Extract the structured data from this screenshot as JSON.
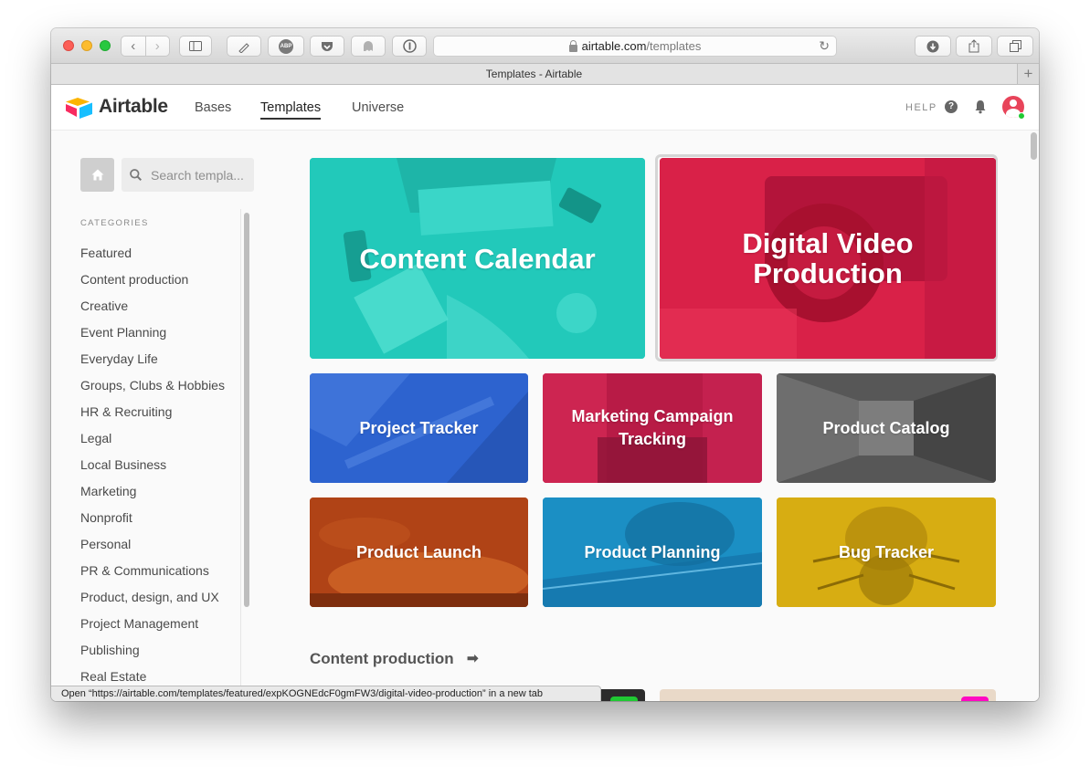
{
  "browser": {
    "url_domain": "airtable.com",
    "url_path": "/templates",
    "tab_title": "Templates - Airtable",
    "status_text": "Open “https://airtable.com/templates/featured/expKOGNEdcF0gmFW3/digital-video-production” in a new tab",
    "toolbar_icons": [
      "back-icon",
      "forward-icon",
      "sidebar-icon",
      "css-extension-icon",
      "adblock-plus-icon",
      "pocket-icon",
      "ghostery-icon",
      "onepassword-icon",
      "download-icon",
      "share-icon",
      "tabs-icon"
    ],
    "abp_label": "ABP",
    "css_label": "CSS"
  },
  "header": {
    "logo_text": "Airtable",
    "nav": [
      {
        "label": "Bases",
        "active": false
      },
      {
        "label": "Templates",
        "active": true
      },
      {
        "label": "Universe",
        "active": false
      }
    ],
    "help_label": "HELP"
  },
  "sidebar": {
    "search_placeholder": "Search templa...",
    "categories_label": "CATEGORIES",
    "categories": [
      "Featured",
      "Content production",
      "Creative",
      "Event Planning",
      "Everyday Life",
      "Groups, Clubs & Hobbies",
      "HR & Recruiting",
      "Legal",
      "Local Business",
      "Marketing",
      "Nonprofit",
      "Personal",
      "PR & Communications",
      "Product, design, and UX",
      "Project Management",
      "Publishing",
      "Real Estate"
    ]
  },
  "featured": {
    "big": [
      {
        "title": "Content Calendar",
        "color": "#22c9ba"
      },
      {
        "title_line1": "Digital Video",
        "title_line2": "Production",
        "color": "#d92148"
      }
    ],
    "small": [
      {
        "title": "Project Tracker",
        "color": "#2d63cf"
      },
      {
        "title_line1": "Marketing Campaign",
        "title_line2": "Tracking",
        "color": "#b81b46"
      },
      {
        "title": "Product Catalog",
        "color": "#575757"
      },
      {
        "title": "Product Launch",
        "color": "#b04316"
      },
      {
        "title": "Product Planning",
        "color": "#1b8fc4"
      },
      {
        "title": "Bug Tracker",
        "color": "#d7ad12"
      }
    ]
  },
  "section": {
    "title": "Content production",
    "arrow": "➡"
  }
}
